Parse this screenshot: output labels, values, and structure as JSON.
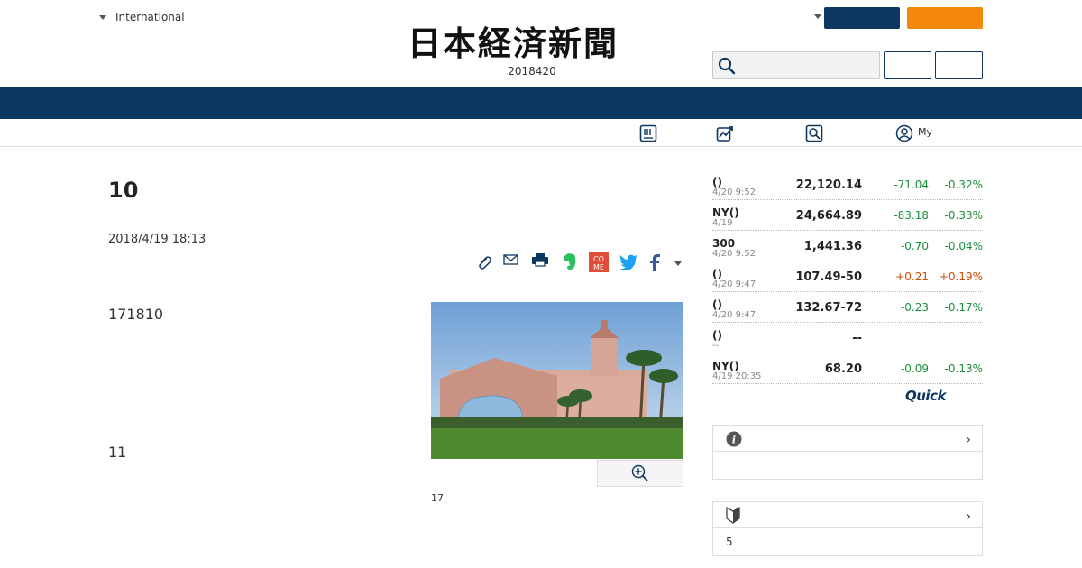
{
  "header": {
    "edition_label": "International",
    "logo_text": "日本経済新聞",
    "date": "2018420"
  },
  "subnav": {
    "my_label": "My"
  },
  "article": {
    "headline": "10",
    "published": "2018/4/19 18:13",
    "paragraph_1": "171810",
    "paragraph_2": "11",
    "photo_caption": "17"
  },
  "market": {
    "rows": [
      {
        "name": "()",
        "time": "4/20 9:52",
        "value": "22,120.14",
        "change": "-71.04",
        "percent": "-0.32%",
        "dir": "down"
      },
      {
        "name": "NY()",
        "time": "4/19",
        "value": "24,664.89",
        "change": "-83.18",
        "percent": "-0.33%",
        "dir": "down"
      },
      {
        "name": "300",
        "time": "4/20 9:52",
        "value": "1,441.36",
        "change": "-0.70",
        "percent": "-0.04%",
        "dir": "down"
      },
      {
        "name": "()",
        "time": "4/20 9:47",
        "value": "107.49-50",
        "change": "+0.21",
        "percent": "+0.19%",
        "dir": "up"
      },
      {
        "name": "()",
        "time": "4/20 9:47",
        "value": "132.67-72",
        "change": "-0.23",
        "percent": "-0.17%",
        "dir": "down"
      },
      {
        "name": "()",
        "time": "--",
        "value": "--",
        "change": "",
        "percent": "",
        "dir": "none"
      },
      {
        "name": "NY()",
        "time": "4/19 20:35",
        "value": "68.20",
        "change": "-0.09",
        "percent": "-0.13%",
        "dir": "down"
      }
    ],
    "quick_logo": "Quick"
  },
  "sidebar_box_2": {
    "body": "5"
  },
  "colors": {
    "navy": "#0b3760",
    "orange": "#f5870f",
    "down": "#1a8f3c",
    "up": "#d14a00"
  },
  "icons": [
    "search-icon",
    "newspaper-icon",
    "chart-icon",
    "search-box-icon",
    "user-icon",
    "clip-icon",
    "mail-icon",
    "print-icon",
    "evernote-icon",
    "come-icon",
    "twitter-icon",
    "facebook-icon",
    "zoom-in-icon",
    "info-icon",
    "beginner-icon",
    "chevron-right-icon"
  ]
}
